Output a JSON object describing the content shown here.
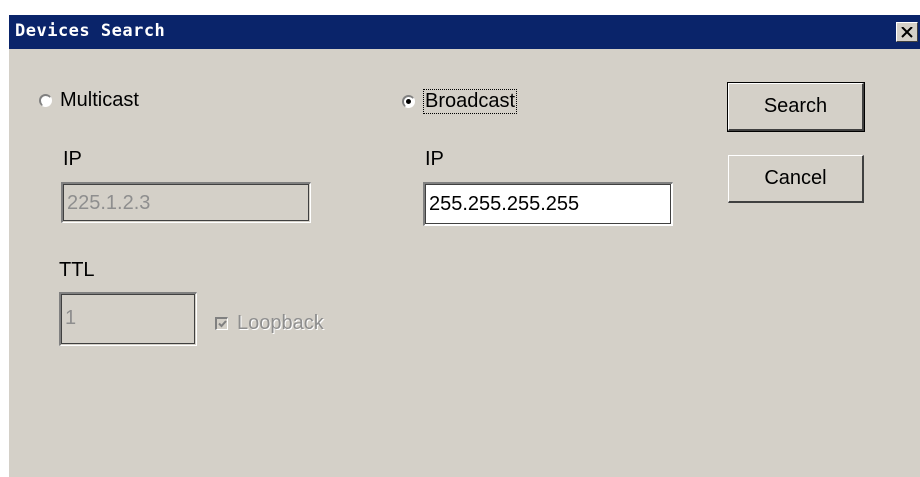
{
  "window": {
    "title": "Devices Search",
    "close_glyph": "✕"
  },
  "multicast": {
    "label": "Multicast",
    "selected": false,
    "ip_label": "IP",
    "ip_value": "225.1.2.3",
    "ttl_label": "TTL",
    "ttl_value": "1",
    "loopback_label": "Loopback",
    "loopback_checked": true
  },
  "broadcast": {
    "label": "Broadcast",
    "selected": true,
    "ip_label": "IP",
    "ip_value": "255.255.255.255"
  },
  "buttons": {
    "search_label": "Search",
    "cancel_label": "Cancel"
  }
}
